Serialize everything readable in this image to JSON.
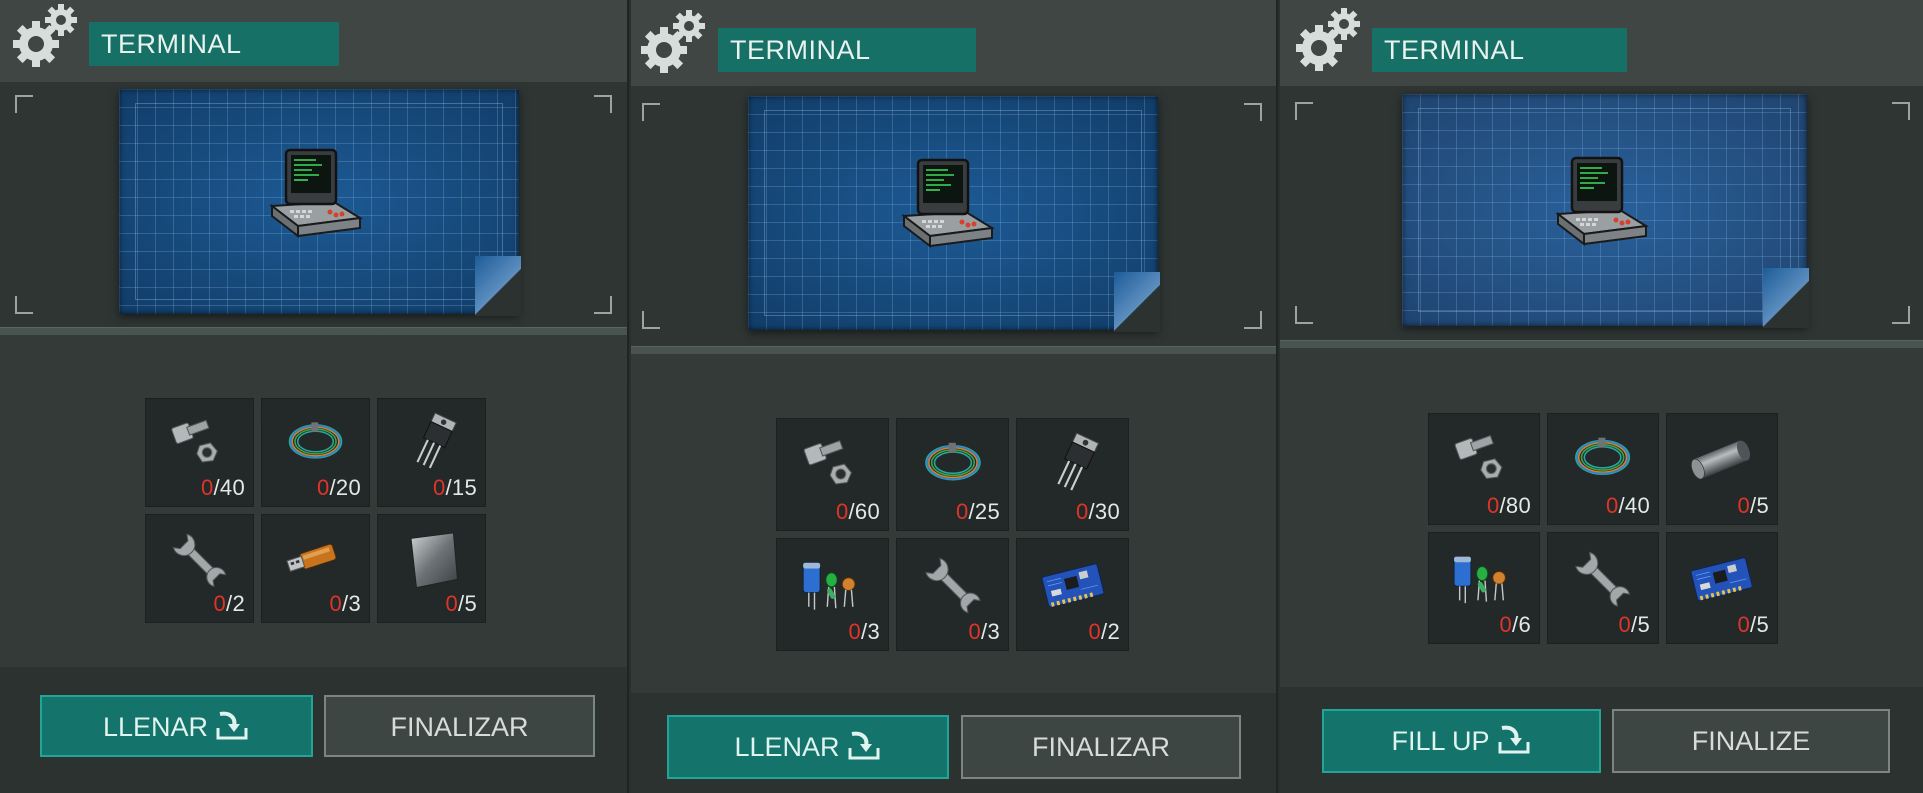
{
  "colors": {
    "accent": "#177066",
    "blueprint": "#17508a",
    "have_count": "#e0342a",
    "button_fill": "#14736a"
  },
  "panels": [
    {
      "title": "TERMINAL",
      "fill_label": "LLENAR",
      "finish_label": "FINALIZAR",
      "items": [
        {
          "icon": "bolt-nut-icon",
          "have": "0",
          "need": "/40"
        },
        {
          "icon": "wire-coil-icon",
          "have": "0",
          "need": "/20"
        },
        {
          "icon": "transistor-icon",
          "have": "0",
          "need": "/15"
        },
        {
          "icon": "wrench-icon",
          "have": "0",
          "need": "/2"
        },
        {
          "icon": "usb-stick-icon",
          "have": "0",
          "need": "/3"
        },
        {
          "icon": "metal-sheet-icon",
          "have": "0",
          "need": "/5"
        }
      ]
    },
    {
      "title": "TERMINAL",
      "fill_label": "LLENAR",
      "finish_label": "FINALIZAR",
      "items": [
        {
          "icon": "bolt-nut-icon",
          "have": "0",
          "need": "/60"
        },
        {
          "icon": "wire-coil-icon",
          "have": "0",
          "need": "/25"
        },
        {
          "icon": "transistor-icon",
          "have": "0",
          "need": "/30"
        },
        {
          "icon": "electronic-components-icon",
          "have": "0",
          "need": "/3"
        },
        {
          "icon": "wrench-icon",
          "have": "0",
          "need": "/3"
        },
        {
          "icon": "circuit-board-icon",
          "have": "0",
          "need": "/2"
        }
      ]
    },
    {
      "title": "TERMINAL",
      "fill_label": "FILL UP",
      "finish_label": "FINALIZE",
      "items": [
        {
          "icon": "bolt-nut-icon",
          "have": "0",
          "need": "/80"
        },
        {
          "icon": "wire-coil-icon",
          "have": "0",
          "need": "/40"
        },
        {
          "icon": "metal-rod-icon",
          "have": "0",
          "need": "/5"
        },
        {
          "icon": "electronic-components-icon",
          "have": "0",
          "need": "/6"
        },
        {
          "icon": "wrench-icon",
          "have": "0",
          "need": "/5"
        },
        {
          "icon": "circuit-board-icon",
          "have": "0",
          "need": "/5"
        }
      ]
    }
  ]
}
